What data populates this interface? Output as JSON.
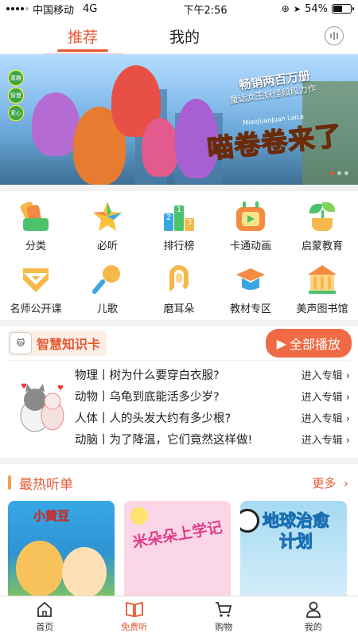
{
  "status": {
    "carrier": "中国移动",
    "network": "4G",
    "time": "下午2:56",
    "battery_percent": 54,
    "battery_text": "54%"
  },
  "top_tabs": [
    {
      "label": "推荐",
      "active": true
    },
    {
      "label": "我的",
      "active": false
    }
  ],
  "banner": {
    "sub1": "畅销两百万册",
    "sub2": "童话女王妖怪段段力作",
    "sub3": "MiaoJuanJuan LaiLe",
    "title": "喵卷卷来了",
    "badges": [
      "童趣",
      "智慧",
      "爱心"
    ]
  },
  "grid_items": [
    {
      "label": "分类",
      "icon": "category-icon"
    },
    {
      "label": "必听",
      "icon": "star-icon"
    },
    {
      "label": "排行榜",
      "icon": "ranking-icon"
    },
    {
      "label": "卡通动画",
      "icon": "tv-icon"
    },
    {
      "label": "启蒙教育",
      "icon": "sprout-icon"
    },
    {
      "label": "名师公开课",
      "icon": "teacher-badge-icon"
    },
    {
      "label": "儿歌",
      "icon": "microphone-icon"
    },
    {
      "label": "磨耳朵",
      "icon": "ear-icon"
    },
    {
      "label": "教材专区",
      "icon": "grad-cap-icon"
    },
    {
      "label": "美声图书馆",
      "icon": "library-icon"
    }
  ],
  "knowledge": {
    "title": "智慧知识卡",
    "play_all": "全部播放",
    "rows": [
      {
        "q": "物理丨树为什么要穿白衣服?",
        "go": "进入专辑"
      },
      {
        "q": "动物丨乌龟到底能活多少岁?",
        "go": "进入专辑"
      },
      {
        "q": "人体丨人的头发大约有多少根?",
        "go": "进入专辑"
      },
      {
        "q": "动脑丨为了降温，它们竟然这样做!",
        "go": "进入专辑"
      }
    ]
  },
  "hot": {
    "title": "最热听单",
    "more": "更多",
    "albums": [
      {
        "name": "小黄豆"
      },
      {
        "name": "米朵朵上学记"
      },
      {
        "name": "地球治愈计划"
      }
    ]
  },
  "bottom_nav": [
    {
      "label": "首页",
      "active": false
    },
    {
      "label": "免费听",
      "active": true
    },
    {
      "label": "购物",
      "active": false
    },
    {
      "label": "我的",
      "active": false
    }
  ],
  "colors": {
    "accent": "#e45a33",
    "play": "#ef6a45"
  }
}
